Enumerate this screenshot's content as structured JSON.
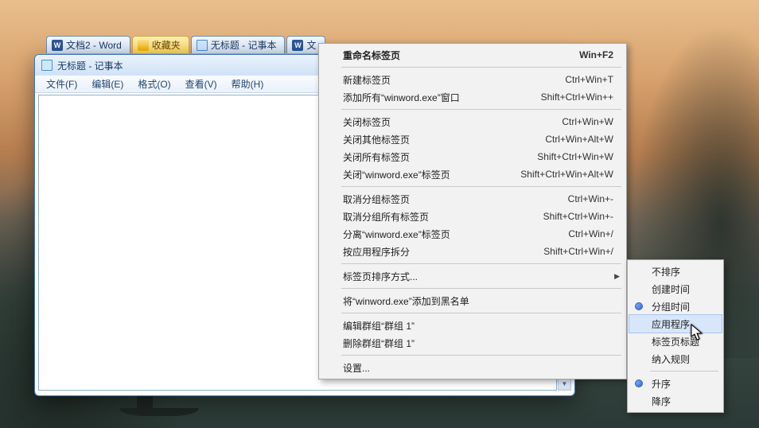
{
  "tabs": [
    {
      "label": "文档2 - Word",
      "icon": "word"
    },
    {
      "label": "收藏夹",
      "icon": "folder"
    },
    {
      "label": "无标题 - 记事本",
      "icon": "note"
    },
    {
      "label": "文",
      "icon": "word"
    }
  ],
  "window": {
    "title": "无标题 - 记事本",
    "menus": [
      "文件(F)",
      "编辑(E)",
      "格式(O)",
      "查看(V)",
      "帮助(H)"
    ]
  },
  "context_menu": {
    "items": [
      {
        "label": "重命名标签页",
        "shortcut": "Win+F2",
        "bold": true
      },
      {
        "sep": true
      },
      {
        "label": "新建标签页",
        "shortcut": "Ctrl+Win+T"
      },
      {
        "label": "添加所有“winword.exe”窗口",
        "shortcut": "Shift+Ctrl+Win++"
      },
      {
        "sep": true
      },
      {
        "label": "关闭标签页",
        "shortcut": "Ctrl+Win+W"
      },
      {
        "label": "关闭其他标签页",
        "shortcut": "Ctrl+Win+Alt+W"
      },
      {
        "label": "关闭所有标签页",
        "shortcut": "Shift+Ctrl+Win+W"
      },
      {
        "label": "关闭“winword.exe”标签页",
        "shortcut": "Shift+Ctrl+Win+Alt+W"
      },
      {
        "sep": true
      },
      {
        "label": "取消分组标签页",
        "shortcut": "Ctrl+Win+-"
      },
      {
        "label": "取消分组所有标签页",
        "shortcut": "Shift+Ctrl+Win+-"
      },
      {
        "label": "分离“winword.exe”标签页",
        "shortcut": "Ctrl+Win+/"
      },
      {
        "label": "按应用程序拆分",
        "shortcut": "Shift+Ctrl+Win+/"
      },
      {
        "sep": true
      },
      {
        "label": "标签页排序方式...",
        "shortcut": "",
        "submenu": true
      },
      {
        "sep": true
      },
      {
        "label": "将“winword.exe”添加到黑名单",
        "shortcut": ""
      },
      {
        "sep": true
      },
      {
        "label": "编辑群组“群组 1”",
        "shortcut": ""
      },
      {
        "label": "删除群组“群组 1”",
        "shortcut": ""
      },
      {
        "sep": true
      },
      {
        "label": "设置...",
        "shortcut": ""
      }
    ]
  },
  "sort_submenu": {
    "items": [
      {
        "label": "不排序"
      },
      {
        "label": "创建时间"
      },
      {
        "label": "分组时间",
        "radio": true
      },
      {
        "label": "应用程序",
        "hover": true
      },
      {
        "label": "标签页标题"
      },
      {
        "label": "纳入规则"
      },
      {
        "sep": true
      },
      {
        "label": "升序",
        "radio": true
      },
      {
        "label": "降序"
      }
    ]
  }
}
